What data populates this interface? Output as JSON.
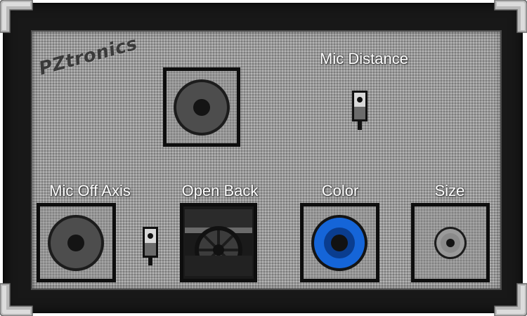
{
  "brand": "PZtronics",
  "labels": {
    "mic_distance": "Mic Distance",
    "mic_off_axis": "Mic Off Axis",
    "open_back": "Open Back",
    "color": "Color",
    "size": "Size"
  },
  "colors": {
    "cabinet": "#181818",
    "grille": "#9b9b9b",
    "color_ring": "#1565d8",
    "label_text": "#ffffff"
  },
  "icons": {
    "speaker": "speaker-cone-icon",
    "switch": "toggle-switch-icon"
  }
}
